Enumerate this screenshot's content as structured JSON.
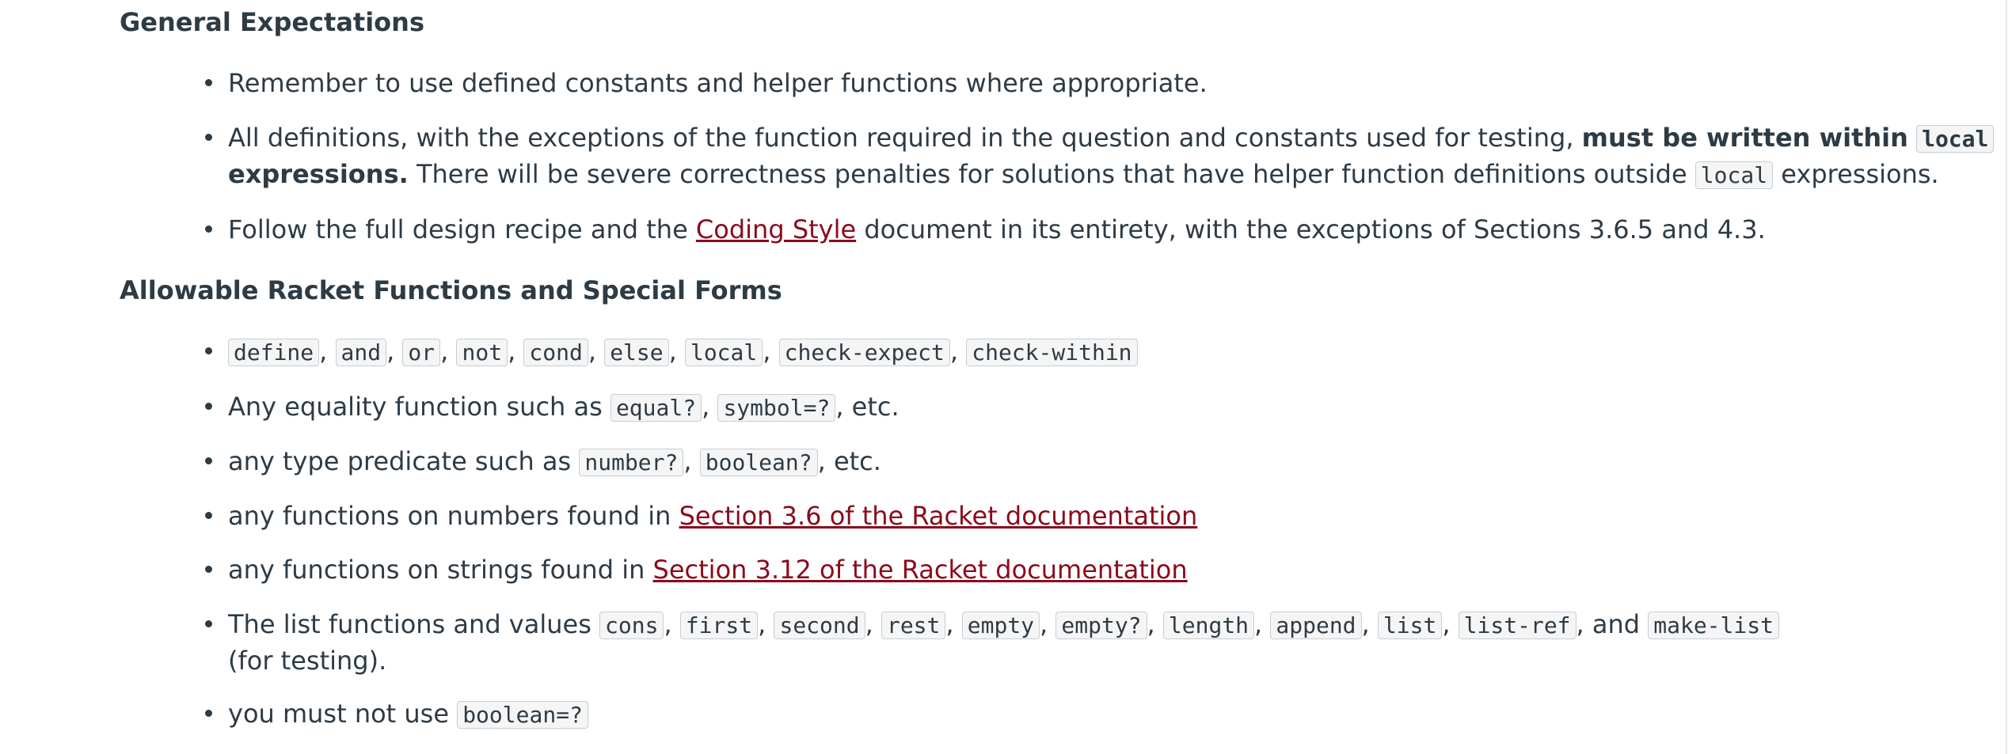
{
  "general": {
    "heading": "General Expectations",
    "item1": "Remember to use defined constants and helper functions where appropriate.",
    "item2": {
      "pre": "All definitions, with the exceptions of the function required in the question and constants used for testing, ",
      "bold": "must be written within",
      "code": "local",
      "bold2": "expressions.",
      "post": " There will be severe correctness penalties for solutions that have helper function definitions outside ",
      "code2": "local",
      "post2": " expressions."
    },
    "item3": {
      "pre": "Follow the full design recipe and the ",
      "link": "Coding Style",
      "post": " document in its entirety, with the exceptions of Sections 3.6.5 and 4.3."
    }
  },
  "allowable": {
    "heading": "Allowable Racket Functions and Special Forms",
    "item1_codes": [
      "define",
      "and",
      "or",
      "not",
      "cond",
      "else",
      "local",
      "check-expect",
      "check-within"
    ],
    "item2": {
      "pre": "Any equality function such as ",
      "codes": [
        "equal?",
        "symbol=?"
      ],
      "post": ", etc."
    },
    "item3": {
      "pre": "any type predicate such as ",
      "codes": [
        "number?",
        "boolean?"
      ],
      "post": ", etc."
    },
    "item4": {
      "pre": "any functions on numbers found in ",
      "link": "Section 3.6 of the Racket documentation"
    },
    "item5": {
      "pre": "any functions on strings found in ",
      "link": "Section 3.12 of the Racket documentation"
    },
    "item6": {
      "pre": "The list functions and values ",
      "codes": [
        "cons",
        "first",
        "second",
        "rest",
        "empty",
        "empty?",
        "length",
        "append",
        "list",
        "list-ref"
      ],
      "and": ", and ",
      "last_code": "make-list",
      "post": "(for testing)."
    },
    "item7": {
      "pre": "you must not use ",
      "code": "boolean=?"
    }
  },
  "colors": {
    "text": "#2d3b45",
    "link": "#8b0a1c",
    "code_border": "#c7cdd1",
    "code_bg": "#f5f5f5"
  }
}
